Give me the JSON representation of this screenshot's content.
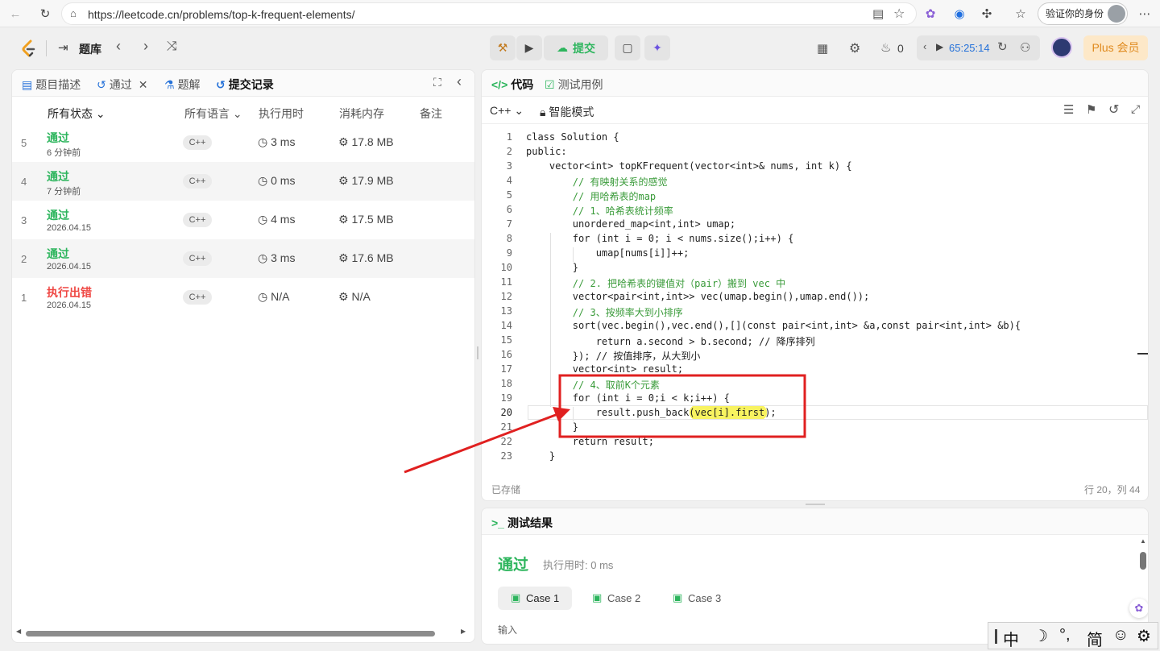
{
  "browser": {
    "url": "https://leetcode.cn/problems/top-k-frequent-elements/",
    "profile_label": "验证你的身份"
  },
  "toolbar": {
    "problem_list_label": "题库",
    "submit_label": "提交",
    "fire_count": "0",
    "timer": "65:25:14",
    "plus_label": "Plus 会员"
  },
  "left_panel": {
    "tabs": [
      "题目描述",
      "通过",
      "题解",
      "提交记录"
    ],
    "columns": {
      "status": "所有状态",
      "language": "所有语言",
      "runtime": "执行用时",
      "memory": "消耗内存",
      "notes": "备注"
    },
    "rows": [
      {
        "num": "5",
        "status": "通过",
        "date": "6 分钟前",
        "lang": "C++",
        "runtime": "3 ms",
        "memory": "17.8 MB"
      },
      {
        "num": "4",
        "status": "通过",
        "date": "7 分钟前",
        "lang": "C++",
        "runtime": "0 ms",
        "memory": "17.9 MB"
      },
      {
        "num": "3",
        "status": "通过",
        "date": "2026.04.15",
        "lang": "C++",
        "runtime": "4 ms",
        "memory": "17.5 MB"
      },
      {
        "num": "2",
        "status": "通过",
        "date": "2026.04.15",
        "lang": "C++",
        "runtime": "3 ms",
        "memory": "17.6 MB"
      },
      {
        "num": "1",
        "status": "执行出错",
        "date": "2026.04.15",
        "lang": "C++",
        "runtime": "N/A",
        "memory": "N/A"
      }
    ]
  },
  "editor": {
    "tabs": [
      "代码",
      "测试用例"
    ],
    "language": "C++",
    "mode": "智能模式",
    "saved": "已存储",
    "cursor": "行 20，列 44",
    "line_numbers": [
      "1",
      "2",
      "3",
      "4",
      "5",
      "6",
      "7",
      "8",
      "9",
      "10",
      "11",
      "12",
      "13",
      "14",
      "15",
      "16",
      "17",
      "18",
      "19",
      "20",
      "21",
      "22",
      "23"
    ],
    "lines": [
      "class Solution {",
      "public:",
      "    vector<int> topKFrequent(vector<int>& nums, int k) {",
      "        // 有映射关系的感觉",
      "        // 用哈希表的map",
      "        // 1、哈希表统计频率",
      "        unordered_map<int,int> umap;",
      "        for (int i = 0; i < nums.size();i++) {",
      "            umap[nums[i]]++;",
      "        }",
      "        // 2. 把哈希表的键值对（pair）搬到 vec 中",
      "        vector<pair<int,int>> vec(umap.begin(),umap.end());",
      "        // 3、按频率大到小排序",
      "        sort(vec.begin(),vec.end(),[](const pair<int,int> &a,const pair<int,int> &b){",
      "            return a.second > b.second; // 降序排列",
      "        }); // 按值排序，从大到小",
      "        vector<int> result;",
      "        // 4、取前K个元素",
      "        for (int i = 0;i < k;i++) {",
      "            result.push_back(vec[i].first);",
      "        }",
      "        return result;",
      "    }"
    ]
  },
  "results": {
    "title": "测试结果",
    "status": "通过",
    "runtime_label": "执行用时: 0 ms",
    "cases": [
      "Case 1",
      "Case 2",
      "Case 3"
    ],
    "input_label": "输入"
  },
  "ime": {
    "items": [
      "中",
      "☽",
      "°,",
      "简",
      "☺",
      "⚙"
    ]
  },
  "colors": {
    "accepted": "#2db55d",
    "error": "#ef4743",
    "annotation": "#e02020",
    "highlight": "#f6ef2b"
  }
}
